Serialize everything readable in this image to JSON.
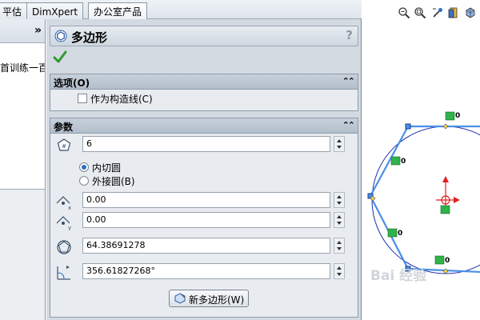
{
  "tabs": [
    {
      "label": "平估"
    },
    {
      "label": "DimXpert"
    },
    {
      "label": "办公室产品"
    }
  ],
  "left_panel": {
    "collapse_label": "»",
    "tree_item": "首训练一百一"
  },
  "property_manager": {
    "title": "多边形",
    "help": "?",
    "options_group": {
      "title": "选项(O)",
      "construction_checkbox": {
        "label": "作为构造线(C)",
        "checked": false
      }
    },
    "parameters_group": {
      "title": "参数",
      "sides_value": "6",
      "inscribed_label": "内切圆",
      "circumscribed_label": "外接圆(B)",
      "selected_mode": "inscribed",
      "center_x": "0.00",
      "center_y": "0.00",
      "diameter": "64.38691278",
      "angle": "356.61827268°"
    },
    "new_polygon_button": "新多边形(W)"
  },
  "graphics": {
    "dimension_labels": [
      "0",
      "0",
      "0",
      "0"
    ],
    "polygon_color": "#4a8fe7",
    "circle_color": "#1e2ea8",
    "origin_color": "#e02020"
  },
  "watermark": "Bai 经验"
}
